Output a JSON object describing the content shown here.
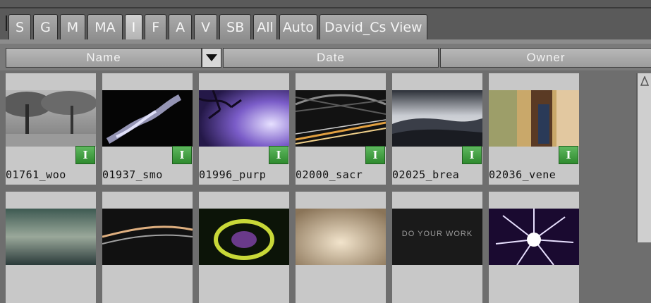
{
  "tabs": [
    {
      "label": "S"
    },
    {
      "label": "G"
    },
    {
      "label": "M"
    },
    {
      "label": "MA"
    },
    {
      "label": "I",
      "active": true
    },
    {
      "label": "F"
    },
    {
      "label": "A"
    },
    {
      "label": "V"
    },
    {
      "label": "SB"
    },
    {
      "label": "All"
    },
    {
      "label": "Auto"
    },
    {
      "label": "David_Cs View"
    }
  ],
  "columns": {
    "name": "Name",
    "date": "Date",
    "owner": "Owner"
  },
  "items": [
    {
      "label": "01761_woo",
      "badge": "I"
    },
    {
      "label": "01937_smo",
      "badge": "I"
    },
    {
      "label": "01996_purp",
      "badge": "I"
    },
    {
      "label": "02000_sacr",
      "badge": "I"
    },
    {
      "label": "02025_brea",
      "badge": "I"
    },
    {
      "label": "02036_vene",
      "badge": "I"
    }
  ],
  "second_row": [
    {
      "thumb_text": "DO YOUR WORK"
    }
  ],
  "colors": {
    "background": "#6e6e6e",
    "badge": "#3a9a3a",
    "tile": "#c8c8c8"
  }
}
